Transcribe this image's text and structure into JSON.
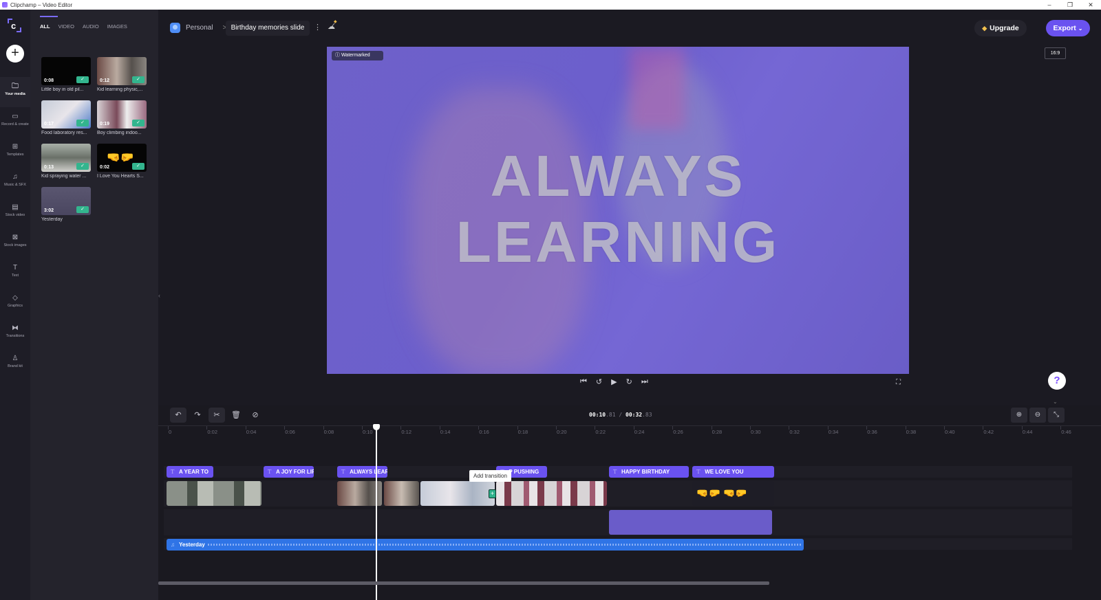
{
  "window": {
    "title": "Clipchamp – Video Editor",
    "controls": [
      "minimize-icon",
      "restore-icon",
      "close-icon"
    ]
  },
  "leftnav": {
    "add_label": "+",
    "items": [
      {
        "label": "Your media",
        "icon": "folder-icon",
        "active": true
      },
      {
        "label": "Record & create",
        "icon": "camera-icon",
        "active": false
      },
      {
        "label": "Templates",
        "icon": "templates-icon",
        "active": false
      },
      {
        "label": "Music & SFX",
        "icon": "music-icon",
        "active": false
      },
      {
        "label": "Stock video",
        "icon": "film-icon",
        "active": false
      },
      {
        "label": "Stock images",
        "icon": "image-icon",
        "active": false
      },
      {
        "label": "Text",
        "icon": "text-icon",
        "active": false
      },
      {
        "label": "Graphics",
        "icon": "shapes-icon",
        "active": false
      },
      {
        "label": "Transitions",
        "icon": "transitions-icon",
        "active": false
      },
      {
        "label": "Brand kit",
        "icon": "brand-icon",
        "active": false
      }
    ]
  },
  "media": {
    "tabs": [
      "ALL",
      "VIDEO",
      "AUDIO",
      "IMAGES"
    ],
    "active_tab": "ALL",
    "items": [
      {
        "duration": "0:08",
        "label": "Little boy in old pil...",
        "added": true
      },
      {
        "duration": "0:12",
        "label": "Kid learning physic,...",
        "added": true
      },
      {
        "duration": "0:17",
        "label": "Food laboratory res...",
        "added": true
      },
      {
        "duration": "0:19",
        "label": "Boy climbing indoo...",
        "added": true
      },
      {
        "duration": "0:13",
        "label": "Kid spraying water ...",
        "added": true
      },
      {
        "duration": "0:02",
        "label": "I Love You Hearts S...",
        "added": true
      },
      {
        "duration": "3:02",
        "label": "Yesterday",
        "added": true
      }
    ],
    "check_glyph": "✓"
  },
  "header": {
    "workspace": "Personal",
    "separator": ">",
    "project_title": "Birthday memories slide",
    "more_glyph": "⋮",
    "upgrade_label": "Upgrade",
    "export_label": "Export",
    "aspect_ratio": "16:9"
  },
  "preview": {
    "watermark_label": "Watermarked",
    "overlay_line1": "ALWAYS",
    "overlay_line2": "LEARNING",
    "accent": "#6f62cc"
  },
  "playback": {
    "skip_back": "⏮",
    "rewind5": "↺",
    "play": "▶",
    "forward5": "↻",
    "skip_forward": "⏭",
    "fullscreen": "⛶",
    "help": "?"
  },
  "timeline": {
    "current_time_main": "00:10",
    "current_time_frac": ".81",
    "separator": " / ",
    "total_time_main": "00:32",
    "total_time_frac": ".83",
    "ruler_ticks": [
      "0",
      "0:02",
      "0:04",
      "0:06",
      "0:08",
      "0:10",
      "0:12",
      "0:14",
      "0:16",
      "0:18",
      "0:20",
      "0:22",
      "0:24",
      "0:26",
      "0:28",
      "0:30",
      "0:32",
      "0:34",
      "0:36",
      "0:38",
      "0:40",
      "0:42",
      "0:44",
      "0:46"
    ],
    "text_clips": [
      {
        "label": "A YEAR TO",
        "start": 0,
        "end": 2.4
      },
      {
        "label": "A JOY FOR LIF",
        "start": 5.0,
        "end": 7.6
      },
      {
        "label": "ALWAYS LEAR",
        "start": 8.8,
        "end": 11.4
      },
      {
        "label": "P PUSHING",
        "start": 17.0,
        "end": 19.6
      },
      {
        "label": "HAPPY BIRTHDAY",
        "start": 22.8,
        "end": 26.9
      },
      {
        "label": "WE LOVE YOU",
        "start": 27.1,
        "end": 31.3
      }
    ],
    "video_clips": [
      {
        "name": "kid-spraying-water",
        "start": 0,
        "end": 4.9
      },
      {
        "name": "kid-learning-physics",
        "start": 8.8,
        "end": 11.1
      },
      {
        "name": "kid-learning-physics-2",
        "start": 11.2,
        "end": 13.0
      },
      {
        "name": "food-laboratory",
        "start": 13.1,
        "end": 16.9
      },
      {
        "name": "boy-climbing",
        "start": 17.0,
        "end": 22.7
      },
      {
        "name": "love-you-hearts",
        "start": 27.1,
        "end": 31.3
      }
    ],
    "shape_clip": {
      "start": 22.8,
      "end": 31.2,
      "color": "#6a5cc9"
    },
    "audio_clip": {
      "label": "Yesterday",
      "start": 0,
      "end": 32.83
    },
    "playhead_seconds": 10.81,
    "tooltip": "Add transition",
    "add_transition_glyph": "+",
    "zoom_in": "⊕",
    "zoom_out": "⊖",
    "fit": "⤡"
  },
  "colors": {
    "brand": "#6a52f0",
    "audio": "#2f74e6",
    "success": "#33b58e"
  }
}
